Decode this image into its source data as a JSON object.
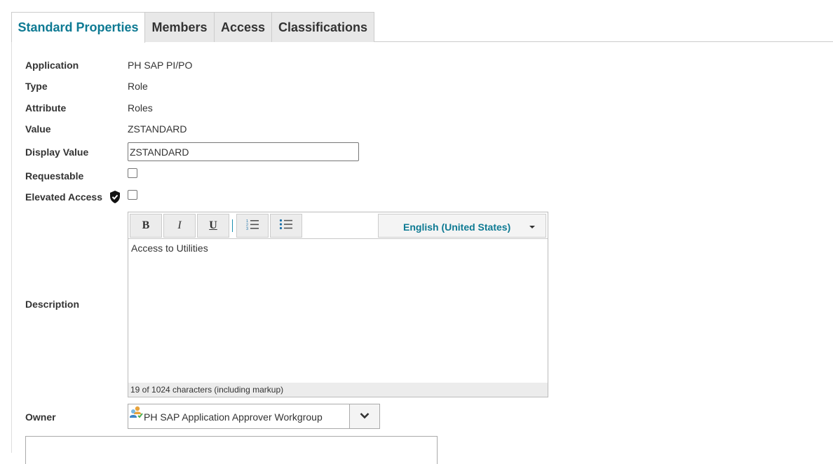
{
  "tabs": [
    {
      "label": "Standard Properties",
      "active": true
    },
    {
      "label": "Members",
      "active": false
    },
    {
      "label": "Access",
      "active": false
    },
    {
      "label": "Classifications",
      "active": false
    }
  ],
  "fields": {
    "application": {
      "label": "Application",
      "value": "PH SAP PI/PO"
    },
    "type": {
      "label": "Type",
      "value": "Role"
    },
    "attribute": {
      "label": "Attribute",
      "value": "Roles"
    },
    "value": {
      "label": "Value",
      "value": "ZSTANDARD"
    },
    "display_value": {
      "label": "Display Value",
      "value": "ZSTANDARD"
    },
    "requestable": {
      "label": "Requestable",
      "checked": false
    },
    "elevated_access": {
      "label": "Elevated Access",
      "checked": false,
      "icon": "shield-check-icon"
    },
    "description": {
      "label": "Description"
    },
    "owner": {
      "label": "Owner",
      "value": "PH SAP Application Approver Workgroup",
      "icon": "workgroup-icon"
    }
  },
  "editor": {
    "toolbar": {
      "bold": "B",
      "italic": "I",
      "underline": "U",
      "ordered_list_icon": "ordered-list-icon",
      "unordered_list_icon": "unordered-list-icon",
      "language": "English (United States)"
    },
    "content": "Access to Utilities",
    "footer": "19 of 1024 characters (including markup)"
  },
  "colors": {
    "accent": "#0e7a93",
    "tab_inactive": "#e8e8e8",
    "border": "#cccccc"
  }
}
